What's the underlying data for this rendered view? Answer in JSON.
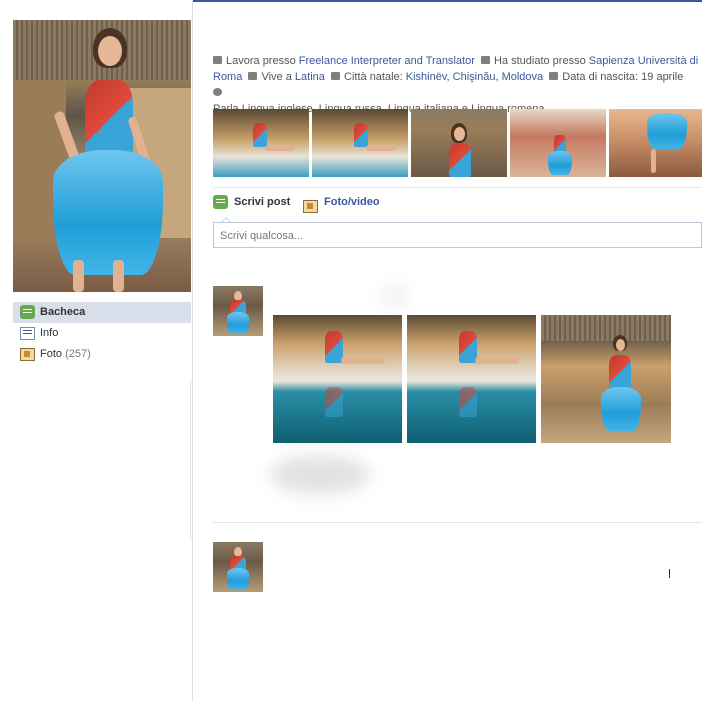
{
  "sidebar": {
    "items": [
      {
        "label": "Bacheca",
        "count": ""
      },
      {
        "label": "Info",
        "count": ""
      },
      {
        "label": "Foto",
        "count": "(257)"
      }
    ]
  },
  "bio": {
    "work_prefix": "Lavora presso ",
    "work_link": "Freelance Interpreter and Translator",
    "study_prefix": "Ha studiato presso ",
    "study_link": "Sapienza Università di Roma",
    "lives_prefix": "Vive a ",
    "lives_link": "Latina",
    "hometown_prefix": "Città natale: ",
    "hometown_link": "Kishinëv, Chişinău, Moldova",
    "birth": "Data di nascita: 19 aprile",
    "languages": "Parla Lingua inglese, Lingua russa, Lingua italiana e Lingua romena"
  },
  "composer": {
    "post_tab": "Scrivi post",
    "photo_tab": "Foto/video",
    "placeholder": "Scrivi qualcosa..."
  },
  "colors": {
    "accent": "#3b5998",
    "active_bg": "#d8dfea"
  },
  "icons": [
    "work-icon",
    "study-icon",
    "home-icon",
    "hometown-icon",
    "calendar-icon",
    "globe-icon",
    "bacheca-icon",
    "info-icon",
    "photo-icon"
  ]
}
